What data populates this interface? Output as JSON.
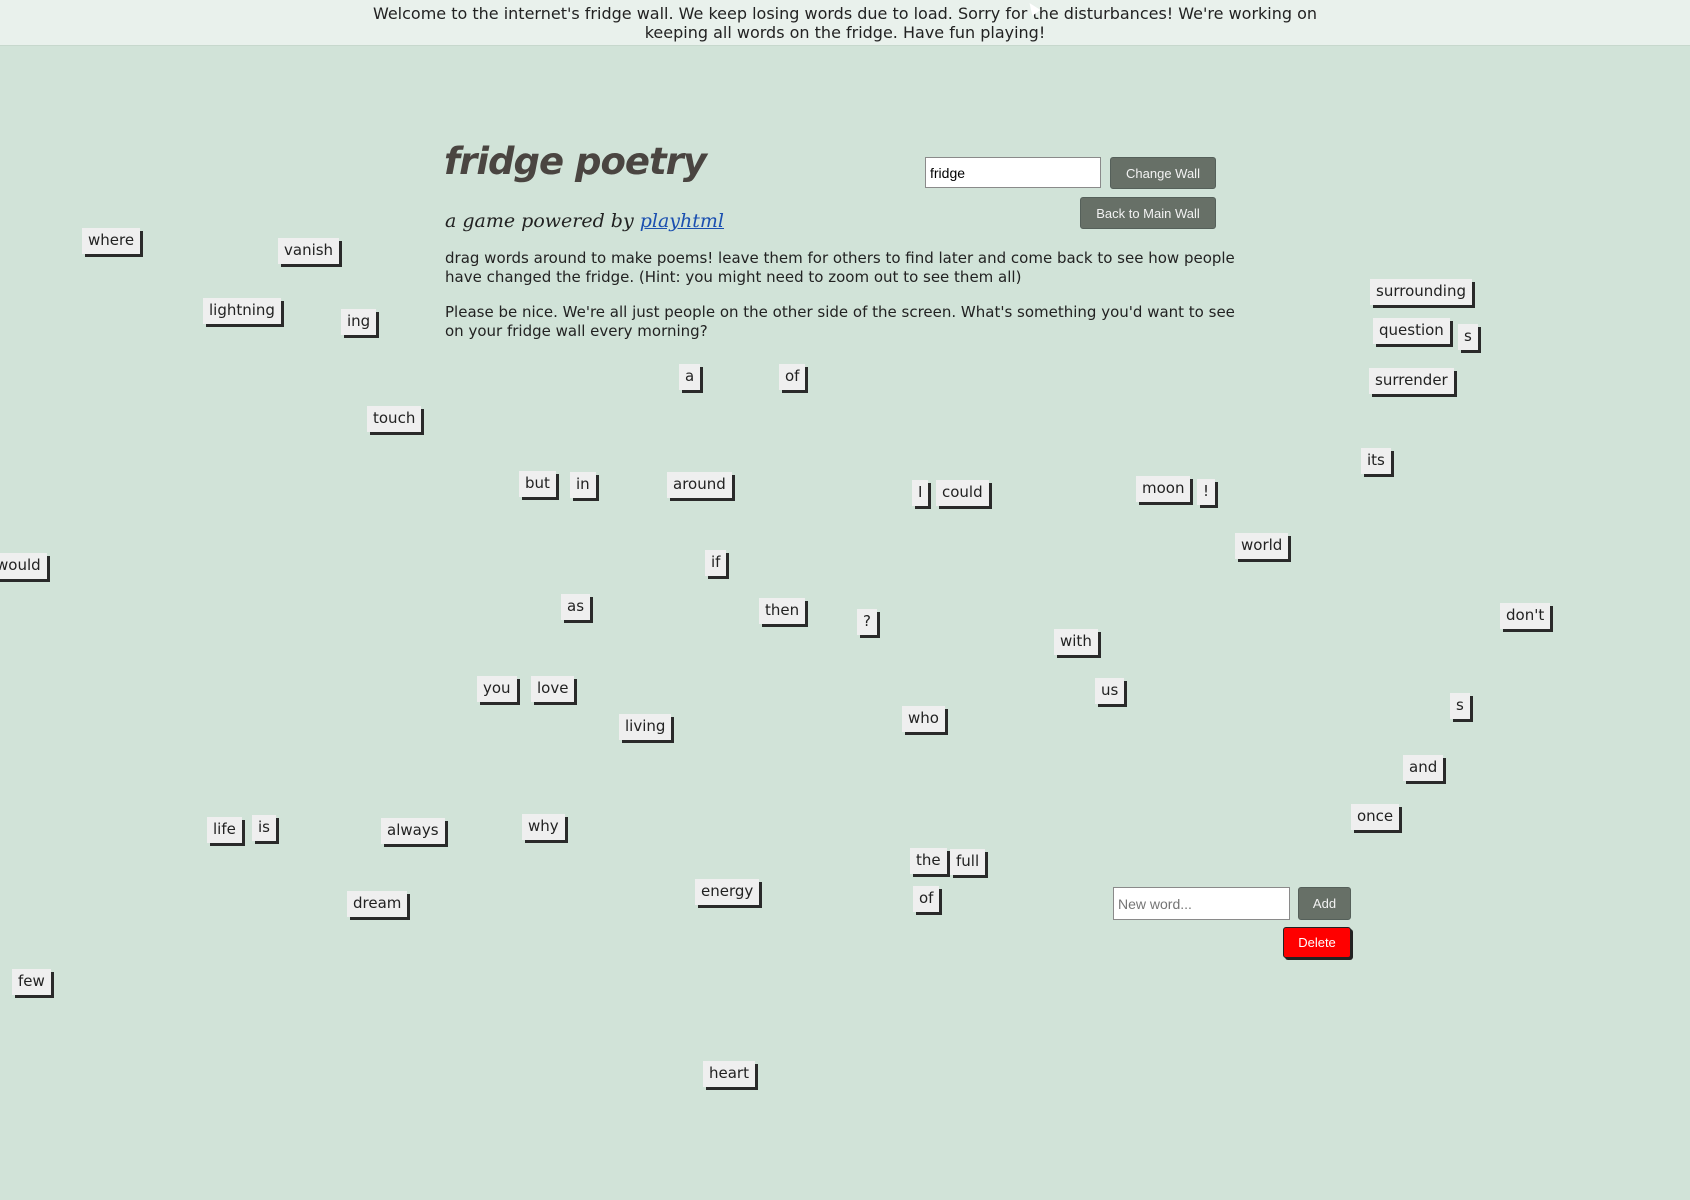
{
  "banner": {
    "text": "Welcome to the internet's fridge wall. We keep losing words due to load. Sorry for the disturbances! We're working on keeping all words on the fridge. Have fun playing!"
  },
  "header": {
    "title": "fridge poetry",
    "subtitle_prefix": "a game powered by ",
    "subtitle_link": "playhtml"
  },
  "description": {
    "para1": "drag words around to make poems! leave them for others to find later and come back to see how people have changed the fridge. (Hint: you might need to zoom out to see them all)",
    "para2": "Please be nice. We're all just people on the other side of the screen. What's something you'd want to see on your fridge wall every morning?"
  },
  "wall_controls": {
    "wall_value": "fridge",
    "change_wall_label": "Change Wall",
    "back_label": "Back to Main Wall"
  },
  "word_controls": {
    "placeholder": "New word...",
    "add_label": "Add",
    "delete_label": "Delete"
  },
  "words": {
    "where": "where",
    "vanish": "vanish",
    "lightning": "lightning",
    "ing": "ing",
    "touch": "touch",
    "would": "would",
    "a": "a",
    "of_1": "of",
    "but": "but",
    "in": "in",
    "around": "around",
    "i": "I",
    "could": "could",
    "moon": "moon",
    "exclaim": "!",
    "its": "its",
    "world": "world",
    "surrounding": "surrounding",
    "question": "question",
    "s_1": "s",
    "surrender": "surrender",
    "if": "if",
    "as": "as",
    "then": "then",
    "qmark": "?",
    "with": "with",
    "dont": "don't",
    "you": "you",
    "love": "love",
    "us": "us",
    "living": "living",
    "who": "who",
    "s_2": "s",
    "and": "and",
    "once": "once",
    "life": "life",
    "is": "is",
    "always": "always",
    "why": "why",
    "the": "the",
    "full": "full",
    "energy": "energy",
    "of_2": "of",
    "dream": "dream",
    "few": "few",
    "heart": "heart"
  }
}
